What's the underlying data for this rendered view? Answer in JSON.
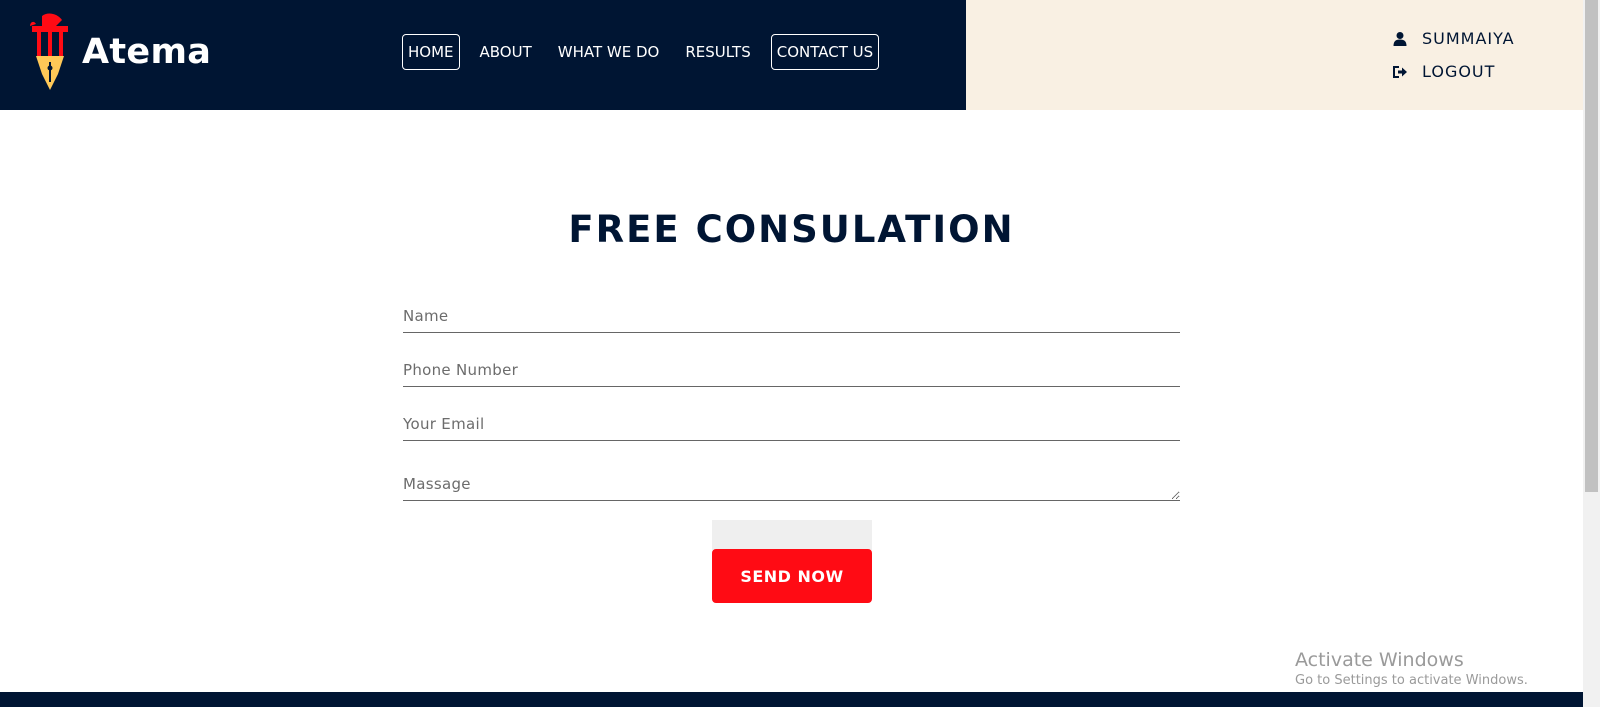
{
  "brand": {
    "name": "Atema",
    "logo_icon": "pen-pillar-logo",
    "colors": {
      "navy": "#001533",
      "cream": "#f9f0e3",
      "red": "#ff0b14",
      "gold": "#ffc857"
    }
  },
  "nav": {
    "items": [
      {
        "label": "HOME",
        "bordered": true
      },
      {
        "label": "ABOUT",
        "bordered": false
      },
      {
        "label": "WHAT WE DO",
        "bordered": false
      },
      {
        "label": "RESULTS",
        "bordered": false
      },
      {
        "label": "CONTACT US",
        "bordered": true
      }
    ]
  },
  "user_menu": {
    "username": "SUMMAIYA",
    "user_icon": "user-icon",
    "logout_label": "LOGOUT",
    "logout_icon": "logout-icon"
  },
  "form": {
    "title": "FREE CONSULATION",
    "name_placeholder": "Name",
    "phone_placeholder": "Phone Number",
    "email_placeholder": "Your Email",
    "message_placeholder": "Massage",
    "submit_label": "SEND NOW"
  },
  "watermark": {
    "title": "Activate Windows",
    "subtitle": "Go to Settings to activate Windows."
  }
}
